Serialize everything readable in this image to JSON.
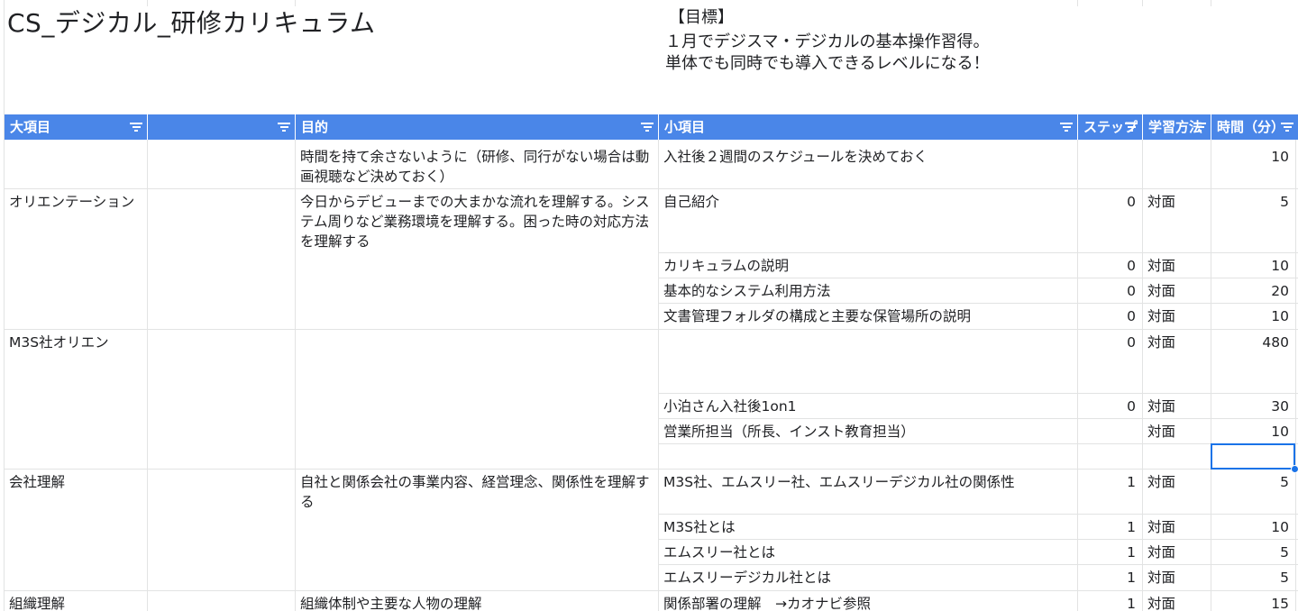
{
  "sheet": {
    "title": "CS_デジカル_研修カリキュラム",
    "goal": {
      "heading": "【目標】",
      "line1": "１月でデジスマ・デジカルの基本操作習得。",
      "line2": "単体でも同時でも導入できるレベルになる！"
    }
  },
  "header": {
    "col_a": "大項目",
    "col_b": "",
    "col_c": "目的",
    "col_d": "小項目",
    "col_e": "ステップ",
    "col_f": "学習方法",
    "col_g": "時間（分）"
  },
  "groups": {
    "g1": {
      "purpose": "時間を持て余さないように（研修、同行がない場合は動画視聴など決めておく）"
    },
    "g2": {
      "category": "オリエンテーション",
      "purpose": "今日からデビューまでの大まかな流れを理解する。システム周りなど業務環境を理解する。困った時の対応方法を理解する"
    },
    "g3": {
      "category": "M3S社オリエン"
    },
    "g4": {
      "category": "会社理解",
      "purpose": "自社と関係会社の事業内容、経営理念、関係性を理解する"
    },
    "g5": {
      "category": "組織理解",
      "purpose": "組織体制や主要な人物の理解"
    }
  },
  "rows": [
    {
      "item": "入社後２週間のスケジュールを決めておく",
      "step": "",
      "method": "",
      "time": "10"
    },
    {
      "item": "自己紹介",
      "step": "0",
      "method": "対面",
      "time": "5"
    },
    {
      "item": "カリキュラムの説明",
      "step": "0",
      "method": "対面",
      "time": "10"
    },
    {
      "item": "基本的なシステム利用方法",
      "step": "0",
      "method": "対面",
      "time": "20"
    },
    {
      "item": "文書管理フォルダの構成と主要な保管場所の説明",
      "step": "0",
      "method": "対面",
      "time": "10"
    },
    {
      "item": "",
      "step": "0",
      "method": "対面",
      "time": "480"
    },
    {
      "item": "小泊さん入社後1on1",
      "step": "0",
      "method": "対面",
      "time": "30"
    },
    {
      "item": "営業所担当（所長、インスト教育担当）",
      "step": "",
      "method": "対面",
      "time": "10"
    },
    {
      "item": "",
      "step": "",
      "method": "",
      "time": ""
    },
    {
      "item": "M3S社、エムスリー社、エムスリーデジカル社の関係性",
      "step": "1",
      "method": "対面",
      "time": "5"
    },
    {
      "item": "M3S社とは",
      "step": "1",
      "method": "対面",
      "time": "10"
    },
    {
      "item": "エムスリー社とは",
      "step": "1",
      "method": "対面",
      "time": "5"
    },
    {
      "item": "エムスリーデジカル社とは",
      "step": "1",
      "method": "対面",
      "time": "5"
    },
    {
      "item": "関係部署の理解　→カオナビ参照",
      "step": "1",
      "method": "対面",
      "time": "15"
    }
  ]
}
